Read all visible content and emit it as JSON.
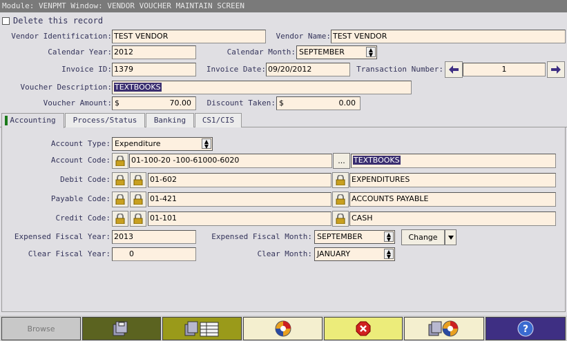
{
  "window": {
    "title": "Module: VENPMT Window: VENDOR VOUCHER MAINTAIN SCREEN"
  },
  "delete_record": {
    "label": "Delete this record",
    "checked": false
  },
  "header_fields": {
    "vendor_id": {
      "label": "Vendor Identification:",
      "value": "TEST VENDOR"
    },
    "vendor_name": {
      "label": "Vendor Name:",
      "value": "TEST VENDOR"
    },
    "calendar_year": {
      "label": "Calendar Year:",
      "value": "2012"
    },
    "calendar_month": {
      "label": "Calendar Month:",
      "value": "SEPTEMBER"
    },
    "invoice_id": {
      "label": "Invoice ID:",
      "value": "1379"
    },
    "invoice_date": {
      "label": "Invoice Date:",
      "value": "09/20/2012"
    },
    "transaction_number": {
      "label": "Transaction Number:",
      "value": "1"
    },
    "voucher_description": {
      "label": "Voucher Description:",
      "value": "TEXTBOOKS"
    },
    "voucher_amount": {
      "label": "Voucher Amount:",
      "currency": "$",
      "value": "70.00"
    },
    "discount_taken": {
      "label": "Discount Taken:",
      "currency": "$",
      "value": "0.00"
    }
  },
  "tabs": [
    {
      "label": "Accounting",
      "active": true
    },
    {
      "label": "Process/Status",
      "active": false
    },
    {
      "label": "Banking",
      "active": false
    },
    {
      "label": "CS1/CIS",
      "active": false
    }
  ],
  "accounting": {
    "account_type": {
      "label": "Account Type:",
      "value": "Expenditure"
    },
    "account_code": {
      "label": "Account Code:",
      "value": "01-100-20 -100-61000-6020",
      "lookup": "...",
      "description": "TEXTBOOKS"
    },
    "debit_code": {
      "label": "Debit Code:",
      "value": "01-602",
      "description": "EXPENDITURES"
    },
    "payable_code": {
      "label": "Payable Code:",
      "value": "01-421",
      "description": "ACCOUNTS PAYABLE"
    },
    "credit_code": {
      "label": "Credit Code:",
      "value": "01-101",
      "description": "CASH"
    },
    "expensed_fiscal_year": {
      "label": "Expensed Fiscal Year:",
      "value": "2013"
    },
    "expensed_fiscal_month": {
      "label": "Expensed Fiscal Month:",
      "value": "SEPTEMBER"
    },
    "change_button": "Change",
    "clear_fiscal_year": {
      "label": "Clear Fiscal Year:",
      "value": "0"
    },
    "clear_month": {
      "label": "Clear Month:",
      "value": "JANUARY"
    }
  },
  "toolbar": {
    "browse_label": "Browse",
    "icons": [
      "browse",
      "save-icon",
      "save-list-icon",
      "refresh-icon",
      "delete-icon",
      "save-refresh-icon",
      "help-icon"
    ],
    "colors": {
      "olive_dark": "#5b6320",
      "olive": "#9a9a1a",
      "cream": "#f4efcf",
      "yellow": "#ecec7a",
      "purple": "#3e2f83"
    }
  }
}
